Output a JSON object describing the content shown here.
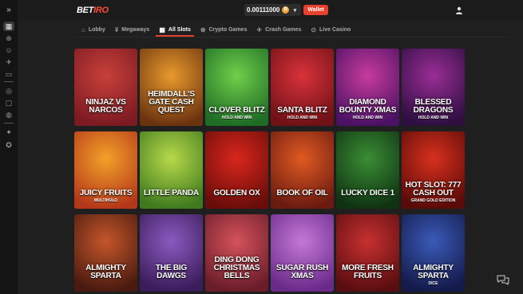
{
  "header": {
    "logo_main": "BET",
    "logo_accent": "IRO",
    "balance": "0.00111000",
    "coin_symbol": "B",
    "wallet_label": "Wallet"
  },
  "sidebar": {
    "items": [
      {
        "icon": "slots-icon",
        "glyph": "▦",
        "active": true
      },
      {
        "icon": "casino-chip-icon",
        "glyph": "⊕",
        "active": false
      },
      {
        "icon": "dealer-icon",
        "glyph": "☺",
        "active": false
      },
      {
        "icon": "rocket-icon",
        "glyph": "✈",
        "active": false
      },
      {
        "icon": "tv-icon",
        "glyph": "▭",
        "active": false
      },
      {
        "icon": "football-icon",
        "glyph": "◎",
        "active": false
      },
      {
        "icon": "ticket-icon",
        "glyph": "▢",
        "active": false
      },
      {
        "icon": "basketball-icon",
        "glyph": "◍",
        "active": false
      },
      {
        "icon": "gift-icon",
        "glyph": "✦",
        "active": false
      },
      {
        "icon": "bonus-icon",
        "glyph": "✪",
        "active": false
      }
    ]
  },
  "tabs": [
    {
      "label": "Lobby",
      "icon": "home-icon",
      "glyph": "⌂",
      "active": false
    },
    {
      "label": "Megaways",
      "icon": "megaways-icon",
      "glyph": "¥",
      "active": false
    },
    {
      "label": "All Slots",
      "icon": "slots-icon",
      "glyph": "▦",
      "active": true
    },
    {
      "label": "Crypto Games",
      "icon": "crypto-icon",
      "glyph": "⊕",
      "active": false
    },
    {
      "label": "Crash Games",
      "icon": "rocket-icon",
      "glyph": "✈",
      "active": false
    },
    {
      "label": "Live Casino",
      "icon": "live-icon",
      "glyph": "⊙",
      "active": false
    }
  ],
  "games": [
    {
      "title": "Ninjaz vs Narcos",
      "subtitle": "",
      "colors": [
        "#c8403a",
        "#7d1a22"
      ]
    },
    {
      "title": "Heimdall's Gate Cash Quest",
      "subtitle": "",
      "colors": [
        "#e89a2c",
        "#6c3310"
      ]
    },
    {
      "title": "Clover Blitz",
      "subtitle": "Hold and Win",
      "colors": [
        "#6fcf4a",
        "#1e6c25"
      ]
    },
    {
      "title": "Santa Blitz",
      "subtitle": "Hold and Win",
      "colors": [
        "#d8323a",
        "#6f1116"
      ]
    },
    {
      "title": "Diamond Bounty Xmas",
      "subtitle": "Hold and Win",
      "colors": [
        "#c63b9c",
        "#4b1164"
      ]
    },
    {
      "title": "Blessed Dragons",
      "subtitle": "Hold and Win",
      "colors": [
        "#9a2d96",
        "#2d0f40"
      ]
    },
    {
      "title": "Juicy Fruits",
      "subtitle": "Multihold",
      "colors": [
        "#f2a128",
        "#b5371a"
      ]
    },
    {
      "title": "Little Panda",
      "subtitle": "",
      "colors": [
        "#b8d94a",
        "#3f7a1e"
      ]
    },
    {
      "title": "Golden Ox",
      "subtitle": "",
      "colors": [
        "#d8261c",
        "#6a0d0a"
      ]
    },
    {
      "title": "Book of Oil",
      "subtitle": "",
      "colors": [
        "#e05a22",
        "#6a1a10"
      ]
    },
    {
      "title": "Lucky Dice 1",
      "subtitle": "",
      "colors": [
        "#3a8d35",
        "#0f3311"
      ]
    },
    {
      "title": "Hot Slot: 777 Cash Out",
      "subtitle": "Grand Gold Edition",
      "colors": [
        "#d8301e",
        "#5a0b08"
      ]
    },
    {
      "title": "Almighty Sparta",
      "subtitle": "",
      "colors": [
        "#c4562a",
        "#4a1a10"
      ]
    },
    {
      "title": "The Big Dawgs",
      "subtitle": "",
      "colors": [
        "#8a5ac0",
        "#3a1c5a"
      ]
    },
    {
      "title": "Ding Dong Christmas Bells",
      "subtitle": "",
      "colors": [
        "#d4525a",
        "#6a1c2a"
      ]
    },
    {
      "title": "Sugar Rush Xmas",
      "subtitle": "",
      "colors": [
        "#c478d6",
        "#6a2a8a"
      ]
    },
    {
      "title": "More Fresh Fruits",
      "subtitle": "",
      "colors": [
        "#c83030",
        "#5a0e10"
      ]
    },
    {
      "title": "Almighty Sparta",
      "subtitle": "Dice",
      "colors": [
        "#3a5ab8",
        "#141a4a"
      ]
    }
  ]
}
